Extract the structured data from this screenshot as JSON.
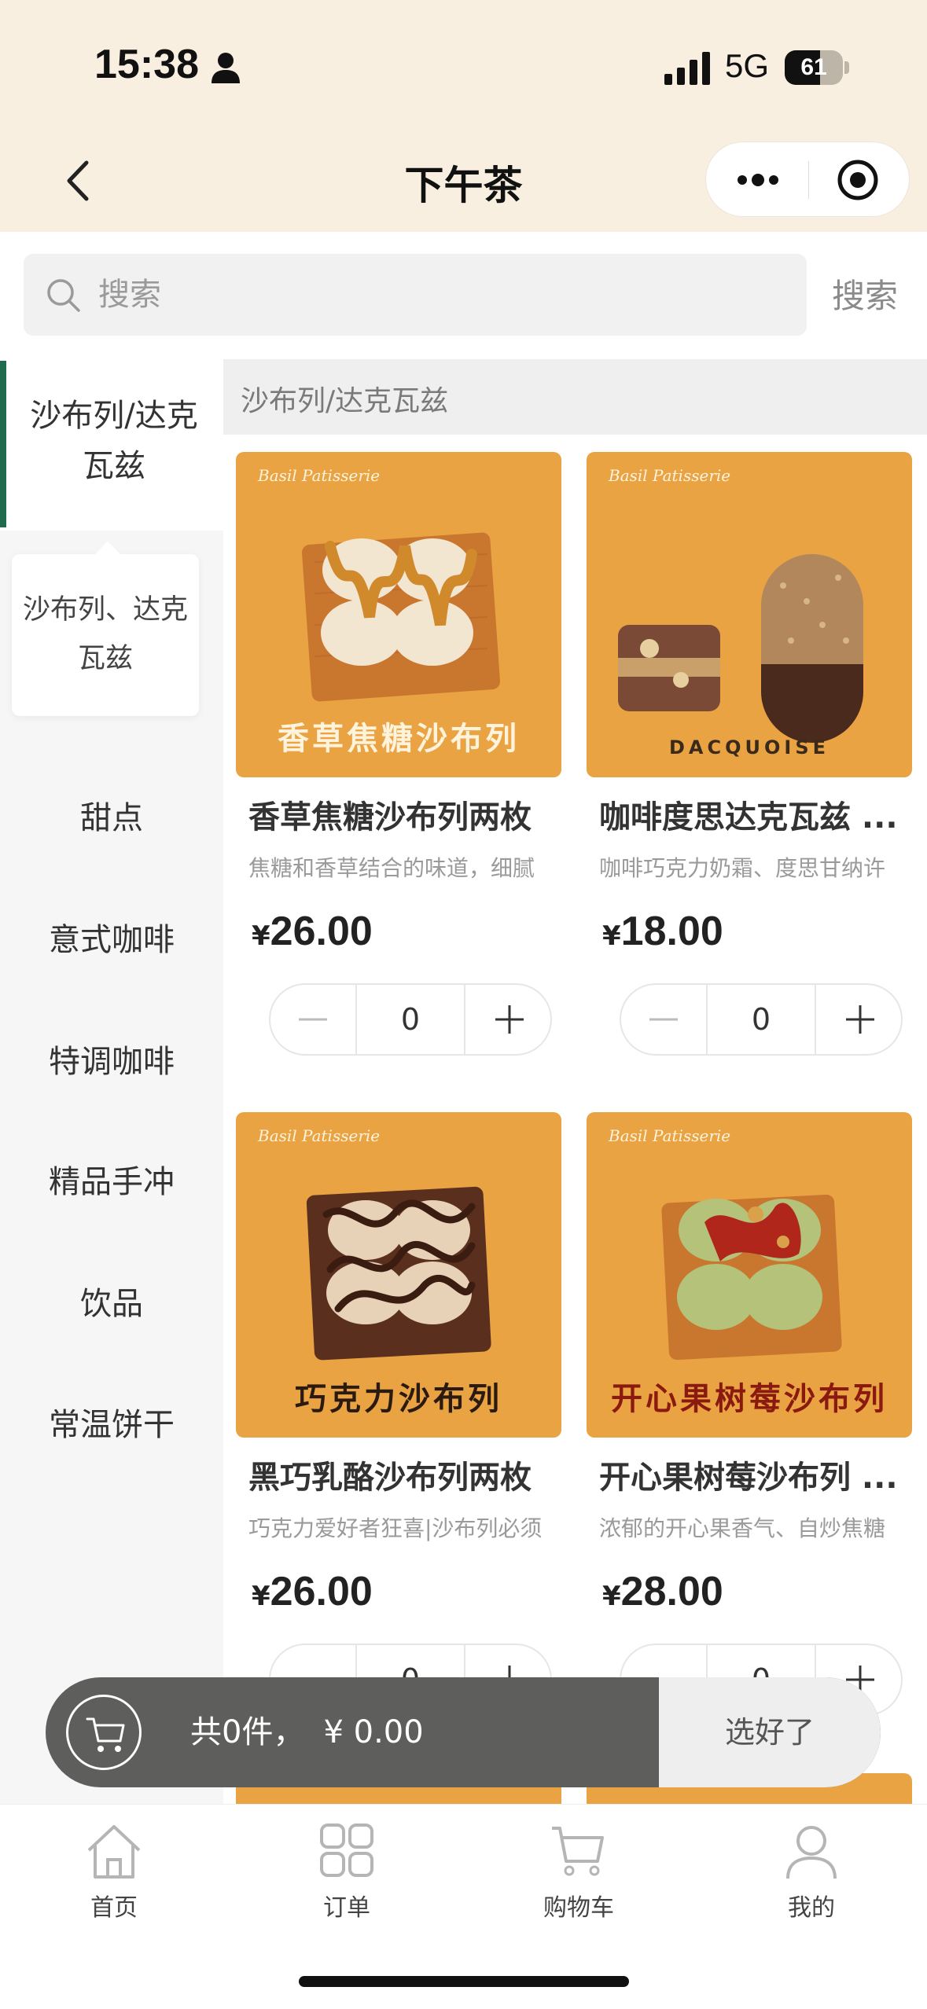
{
  "status_bar": {
    "time": "15:38",
    "network": "5G",
    "battery": "61",
    "battery_level": 0.61
  },
  "nav": {
    "title": "下午茶"
  },
  "search": {
    "placeholder": "搜索",
    "button": "搜索"
  },
  "sidebar": {
    "active": "沙布列/达克瓦兹",
    "sub_active": "沙布列、达克瓦兹",
    "items": [
      "甜点",
      "意式咖啡",
      "特调咖啡",
      "精品手冲",
      "饮品",
      "常温饼干"
    ]
  },
  "category_header": "沙布列/达克瓦兹",
  "brand_mark": "Basil Patisserie",
  "products": [
    {
      "name": "香草焦糖沙布列两枚",
      "desc": "焦糖和香草结合的味道，细腻",
      "currency": "¥",
      "price": "26.00",
      "qty": "0",
      "caption": "香草焦糖沙布列",
      "caption_color": "#fff3dc"
    },
    {
      "name": "咖啡度思达克瓦兹 ...",
      "desc": "咖啡巧克力奶霜、度思甘纳许",
      "currency": "¥",
      "price": "18.00",
      "qty": "0",
      "caption": "DACQUOISE",
      "caption_color": "#3a2a1c"
    },
    {
      "name": "黑巧乳酪沙布列两枚",
      "desc": "巧克力爱好者狂喜|沙布列必须",
      "currency": "¥",
      "price": "26.00",
      "qty": "0",
      "caption": "巧克力沙布列",
      "caption_color": "#2a1a10"
    },
    {
      "name": "开心果树莓沙布列 ...",
      "desc": "浓郁的开心果香气、自炒焦糖",
      "currency": "¥",
      "price": "28.00",
      "qty": "0",
      "caption": "开心果树莓沙布列",
      "caption_color": "#8a1a10"
    }
  ],
  "cart": {
    "count_text": "共0件，",
    "total": "¥ 0.00",
    "confirm": "选好了"
  },
  "tabbar": [
    {
      "label": "首页",
      "icon": "home-icon"
    },
    {
      "label": "订单",
      "icon": "grid-icon"
    },
    {
      "label": "购物车",
      "icon": "cart-icon"
    },
    {
      "label": "我的",
      "icon": "user-icon"
    }
  ],
  "colors": {
    "header_bg": "#f8efe0",
    "accent": "#1e6b4d",
    "product_bg": "#e9a343",
    "cart_bar": "#5e5e5c"
  }
}
